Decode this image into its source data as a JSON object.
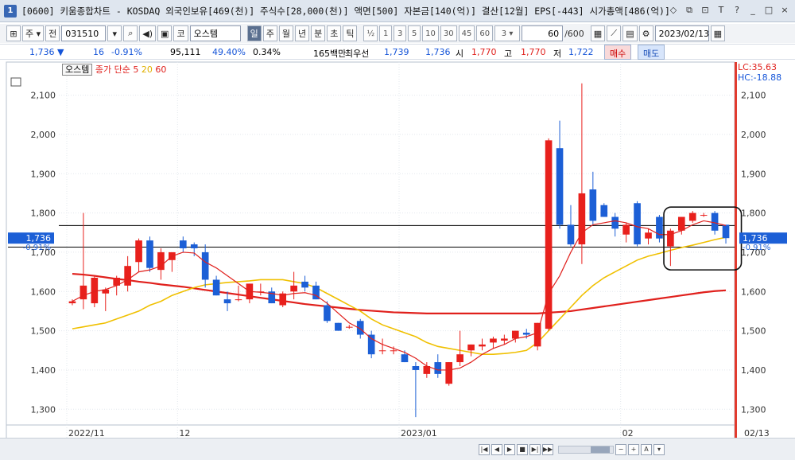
{
  "window": {
    "badge": "1",
    "title": "[0600] 키움종합차트 - KOSDAQ 외국인보유[469(천)] 주식수[28,000(천)] 액면[500] 자본금[140(억)] 결산[12월] EPS[-443] 시가총액[486(억)]",
    "controls": [
      "◇",
      "⧉",
      "⊡",
      "T",
      "?",
      "_",
      "□",
      "×"
    ]
  },
  "toolbar": {
    "type_main": "주",
    "type_toggle": "전",
    "code": "031510",
    "name_prefix": "코",
    "stock_name": "오스템",
    "periods": [
      "일",
      "주",
      "월",
      "년",
      "분",
      "초",
      "틱"
    ],
    "selected_period": "일",
    "half": "½",
    "intervals": [
      "1",
      "3",
      "5",
      "10",
      "30",
      "45",
      "60"
    ],
    "interval_select": "3",
    "count": "60",
    "count_total": "/600",
    "date": "2023/02/13"
  },
  "quote": {
    "price": "1,736",
    "arrow": "▼",
    "change": "16",
    "change_pct": "-0.91%",
    "volume": "95,111",
    "ratio": "49.40%",
    "turnover": "0.34%",
    "amount": "165백만",
    "best_label": "최우선",
    "best_ask": "1,739",
    "best_bid": "1,736",
    "open_label": "시",
    "open": "1,770",
    "high_label": "고",
    "high": "1,770",
    "low_label": "저",
    "low": "1,722",
    "buy_label": "매수",
    "sell_label": "매도"
  },
  "legend": {
    "stock": "오스템",
    "ma_label": "종가 단순",
    "ma5": "5",
    "ma20": "20",
    "ma60": "60"
  },
  "indicators": {
    "lc": "LC:35.63",
    "hc": "HC:-18.88"
  },
  "colors": {
    "up": "#e8201c",
    "down": "#1c5fd6",
    "ma5": "#e0201c",
    "ma20": "#f0c000",
    "ma60": "#e0201c",
    "grid": "#e3e8ee"
  },
  "chart_data": {
    "type": "candlestick",
    "ylim": [
      1260,
      2160
    ],
    "y_ticks": [
      2100,
      2000,
      1900,
      1800,
      1700,
      1600,
      1500,
      1400,
      1300
    ],
    "y_tick_labels": [
      "2,100",
      "2,000",
      "1,900",
      "1,800",
      "1,700",
      "1,600",
      "1,500",
      "1,400",
      "1,300"
    ],
    "x_labels": [
      {
        "label": "2022/11",
        "index": 0
      },
      {
        "label": "12",
        "index": 10
      },
      {
        "label": "2023/01",
        "index": 30
      },
      {
        "label": "02",
        "index": 50
      },
      {
        "label": "02/13",
        "index": 59
      }
    ],
    "current_price": "1,736",
    "current_change": "-0.91%",
    "current_value": 1736,
    "hline_upper": 1768,
    "hline_lower": 1713,
    "candles": [
      {
        "o": 1570,
        "h": 1580,
        "l": 1565,
        "c": 1575
      },
      {
        "o": 1580,
        "h": 1800,
        "l": 1555,
        "c": 1615
      },
      {
        "o": 1570,
        "h": 1640,
        "l": 1560,
        "c": 1635
      },
      {
        "o": 1595,
        "h": 1610,
        "l": 1550,
        "c": 1605
      },
      {
        "o": 1615,
        "h": 1640,
        "l": 1590,
        "c": 1635
      },
      {
        "o": 1615,
        "h": 1690,
        "l": 1600,
        "c": 1665
      },
      {
        "o": 1675,
        "h": 1735,
        "l": 1650,
        "c": 1730
      },
      {
        "o": 1730,
        "h": 1740,
        "l": 1650,
        "c": 1660
      },
      {
        "o": 1655,
        "h": 1710,
        "l": 1630,
        "c": 1700
      },
      {
        "o": 1680,
        "h": 1700,
        "l": 1650,
        "c": 1700
      },
      {
        "o": 1730,
        "h": 1740,
        "l": 1700,
        "c": 1710
      },
      {
        "o": 1720,
        "h": 1725,
        "l": 1690,
        "c": 1710
      },
      {
        "o": 1700,
        "h": 1720,
        "l": 1610,
        "c": 1630
      },
      {
        "o": 1630,
        "h": 1640,
        "l": 1590,
        "c": 1590
      },
      {
        "o": 1580,
        "h": 1600,
        "l": 1550,
        "c": 1570
      },
      {
        "o": 1580,
        "h": 1615,
        "l": 1575,
        "c": 1580
      },
      {
        "o": 1580,
        "h": 1620,
        "l": 1570,
        "c": 1620
      },
      {
        "o": 1600,
        "h": 1620,
        "l": 1590,
        "c": 1600
      },
      {
        "o": 1600,
        "h": 1610,
        "l": 1570,
        "c": 1570
      },
      {
        "o": 1565,
        "h": 1600,
        "l": 1560,
        "c": 1595
      },
      {
        "o": 1600,
        "h": 1650,
        "l": 1580,
        "c": 1615
      },
      {
        "o": 1625,
        "h": 1640,
        "l": 1600,
        "c": 1610
      },
      {
        "o": 1615,
        "h": 1625,
        "l": 1580,
        "c": 1580
      },
      {
        "o": 1565,
        "h": 1575,
        "l": 1520,
        "c": 1525
      },
      {
        "o": 1520,
        "h": 1520,
        "l": 1500,
        "c": 1500
      },
      {
        "o": 1510,
        "h": 1515,
        "l": 1505,
        "c": 1510
      },
      {
        "o": 1525,
        "h": 1530,
        "l": 1480,
        "c": 1490
      },
      {
        "o": 1490,
        "h": 1500,
        "l": 1430,
        "c": 1440
      },
      {
        "o": 1450,
        "h": 1480,
        "l": 1440,
        "c": 1450
      },
      {
        "o": 1450,
        "h": 1460,
        "l": 1440,
        "c": 1450
      },
      {
        "o": 1440,
        "h": 1450,
        "l": 1420,
        "c": 1420
      },
      {
        "o": 1410,
        "h": 1420,
        "l": 1280,
        "c": 1400
      },
      {
        "o": 1390,
        "h": 1420,
        "l": 1380,
        "c": 1410
      },
      {
        "o": 1420,
        "h": 1440,
        "l": 1380,
        "c": 1390
      },
      {
        "o": 1365,
        "h": 1420,
        "l": 1360,
        "c": 1420
      },
      {
        "o": 1420,
        "h": 1500,
        "l": 1410,
        "c": 1440
      },
      {
        "o": 1450,
        "h": 1465,
        "l": 1435,
        "c": 1465
      },
      {
        "o": 1460,
        "h": 1480,
        "l": 1450,
        "c": 1465
      },
      {
        "o": 1470,
        "h": 1485,
        "l": 1455,
        "c": 1480
      },
      {
        "o": 1475,
        "h": 1490,
        "l": 1465,
        "c": 1480
      },
      {
        "o": 1480,
        "h": 1500,
        "l": 1470,
        "c": 1500
      },
      {
        "o": 1495,
        "h": 1505,
        "l": 1480,
        "c": 1490
      },
      {
        "o": 1460,
        "h": 1520,
        "l": 1450,
        "c": 1520
      },
      {
        "o": 1505,
        "h": 1990,
        "l": 1500,
        "c": 1985
      },
      {
        "o": 1965,
        "h": 2035,
        "l": 1760,
        "c": 1770
      },
      {
        "o": 1770,
        "h": 1820,
        "l": 1715,
        "c": 1720
      },
      {
        "o": 1720,
        "h": 2130,
        "l": 1670,
        "c": 1850
      },
      {
        "o": 1860,
        "h": 1905,
        "l": 1770,
        "c": 1780
      },
      {
        "o": 1820,
        "h": 1825,
        "l": 1790,
        "c": 1790
      },
      {
        "o": 1790,
        "h": 1800,
        "l": 1740,
        "c": 1760
      },
      {
        "o": 1745,
        "h": 1775,
        "l": 1725,
        "c": 1770
      },
      {
        "o": 1825,
        "h": 1830,
        "l": 1715,
        "c": 1720
      },
      {
        "o": 1735,
        "h": 1760,
        "l": 1720,
        "c": 1750
      },
      {
        "o": 1790,
        "h": 1795,
        "l": 1725,
        "c": 1735
      },
      {
        "o": 1715,
        "h": 1760,
        "l": 1665,
        "c": 1755
      },
      {
        "o": 1755,
        "h": 1790,
        "l": 1745,
        "c": 1790
      },
      {
        "o": 1780,
        "h": 1805,
        "l": 1775,
        "c": 1800
      },
      {
        "o": 1795,
        "h": 1800,
        "l": 1790,
        "c": 1795
      },
      {
        "o": 1800,
        "h": 1805,
        "l": 1745,
        "c": 1755
      },
      {
        "o": 1770,
        "h": 1770,
        "l": 1722,
        "c": 1736
      }
    ],
    "ma5": [
      1575,
      1590,
      1600,
      1605,
      1615,
      1630,
      1650,
      1655,
      1665,
      1690,
      1700,
      1698,
      1675,
      1660,
      1640,
      1620,
      1600,
      1598,
      1595,
      1590,
      1595,
      1597,
      1590,
      1570,
      1545,
      1520,
      1505,
      1480,
      1465,
      1455,
      1445,
      1430,
      1410,
      1400,
      1400,
      1405,
      1420,
      1440,
      1455,
      1465,
      1480,
      1485,
      1495,
      1595,
      1640,
      1700,
      1750,
      1770,
      1775,
      1780,
      1775,
      1765,
      1760,
      1745,
      1745,
      1755,
      1770,
      1780,
      1775,
      1768
    ],
    "ma20": [
      1505,
      1510,
      1515,
      1520,
      1530,
      1540,
      1550,
      1565,
      1575,
      1590,
      1600,
      1610,
      1617,
      1620,
      1623,
      1625,
      1627,
      1630,
      1630,
      1630,
      1625,
      1620,
      1610,
      1595,
      1580,
      1565,
      1550,
      1530,
      1515,
      1505,
      1495,
      1485,
      1470,
      1460,
      1455,
      1450,
      1445,
      1440,
      1440,
      1442,
      1445,
      1450,
      1470,
      1500,
      1530,
      1560,
      1590,
      1615,
      1635,
      1650,
      1665,
      1680,
      1690,
      1697,
      1705,
      1712,
      1718,
      1725,
      1732,
      1738
    ],
    "ma60": [
      1645,
      1643,
      1640,
      1636,
      1632,
      1629,
      1625,
      1622,
      1618,
      1615,
      1612,
      1608,
      1604,
      1600,
      1596,
      1592,
      1588,
      1584,
      1580,
      1576,
      1572,
      1568,
      1565,
      1562,
      1559,
      1556,
      1553,
      1551,
      1549,
      1547,
      1546,
      1545,
      1544,
      1544,
      1544,
      1544,
      1544,
      1544,
      1544,
      1544,
      1544,
      1544,
      1544,
      1546,
      1548,
      1550,
      1554,
      1558,
      1562,
      1566,
      1570,
      1574,
      1578,
      1582,
      1586,
      1590,
      1594,
      1598,
      1601,
      1603
    ]
  }
}
